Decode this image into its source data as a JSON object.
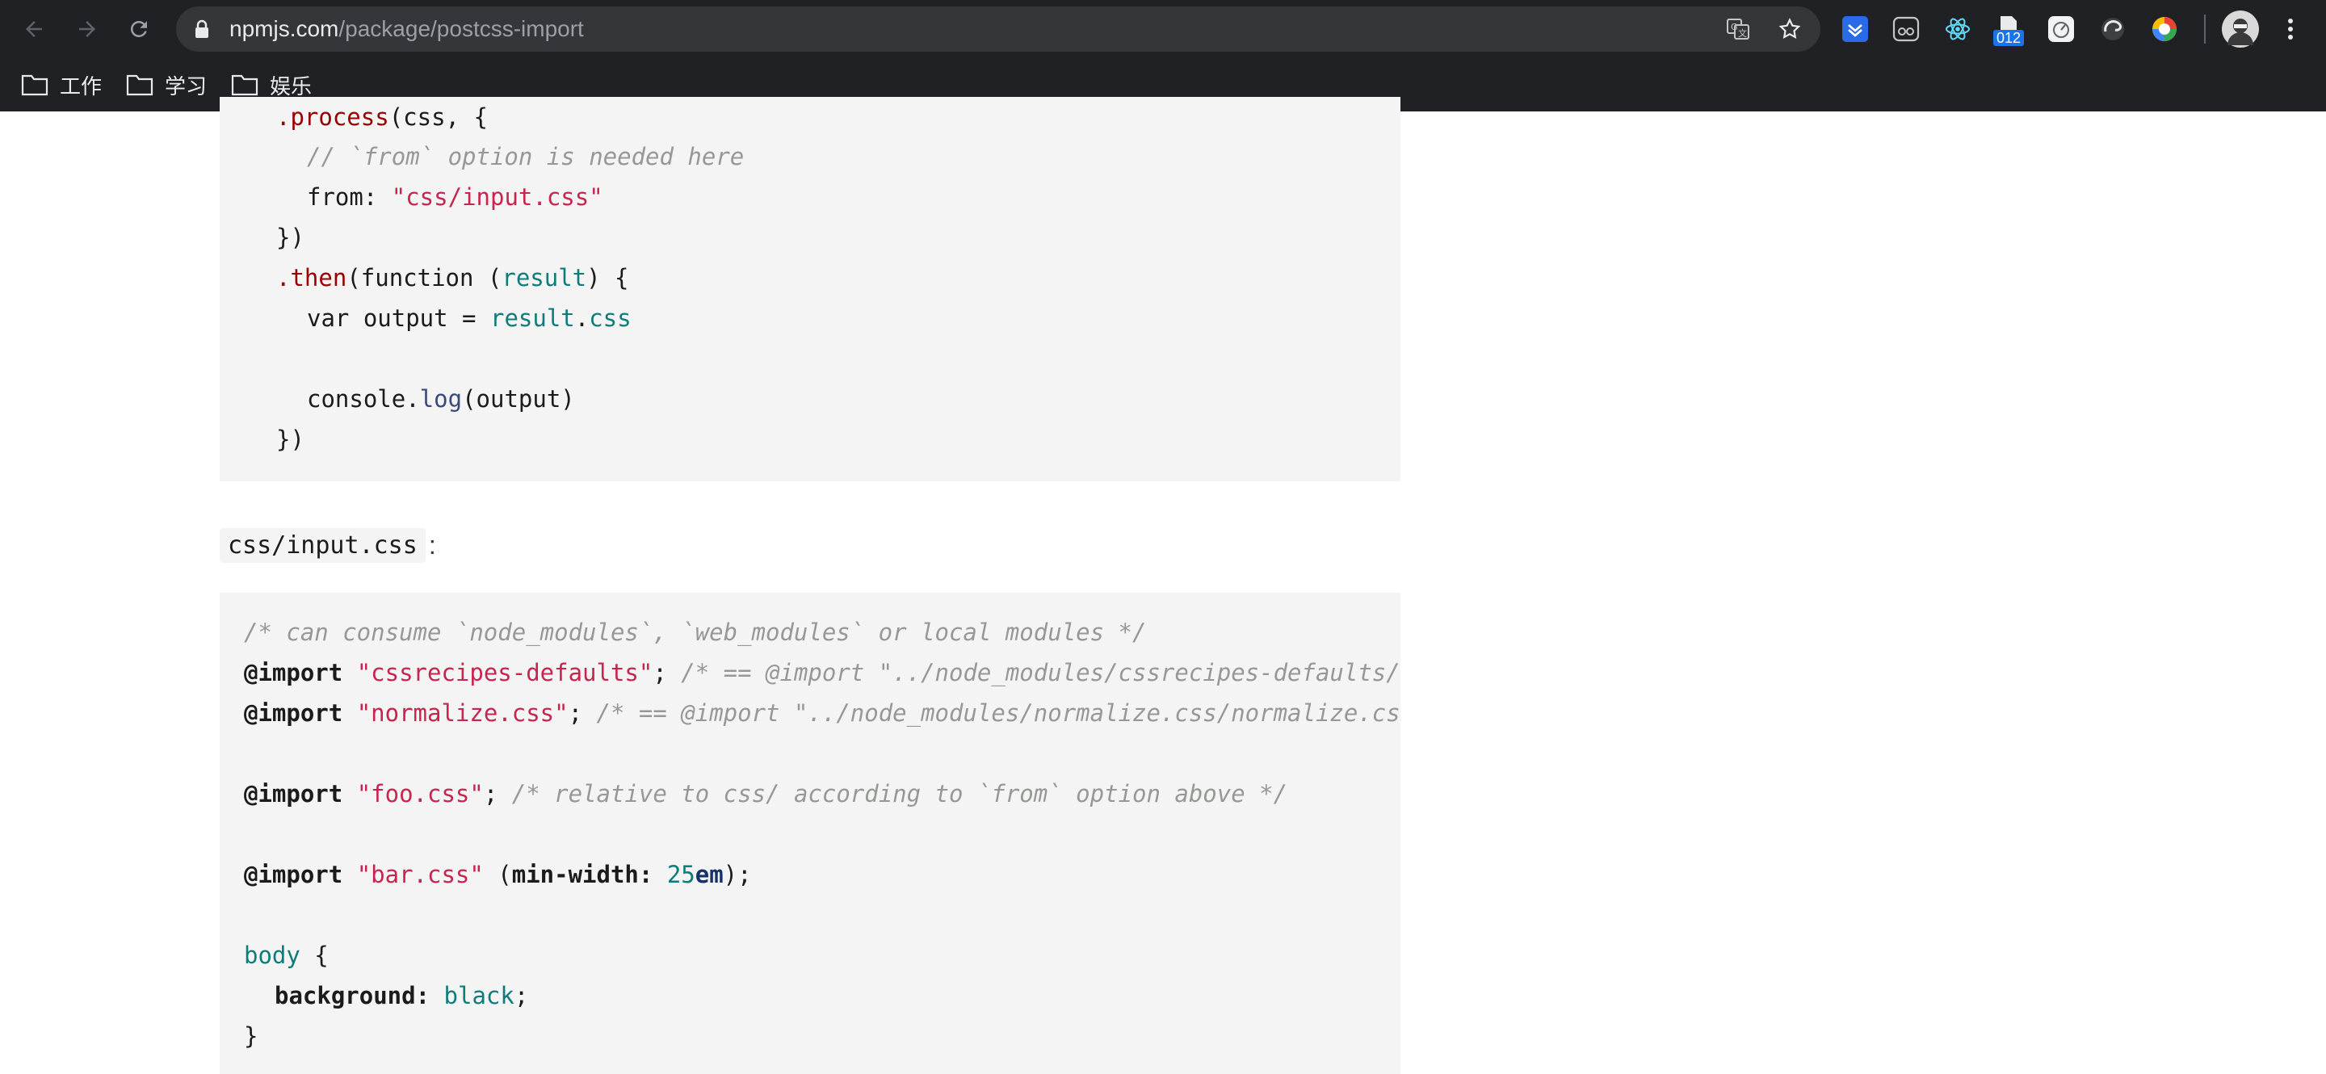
{
  "browser": {
    "url_host": "npmjs.com",
    "url_path": "/package/postcss-import",
    "extension_badge": "012",
    "bookmarks": [
      {
        "label": "工作"
      },
      {
        "label": "学习"
      },
      {
        "label": "娱乐"
      }
    ]
  },
  "page": {
    "js_code": {
      "l1_method": ".process",
      "l1_rest": "(css, {",
      "l2_comment": "// `from` option is needed here",
      "l3_key": "from: ",
      "l3_value": "\"css/input.css\"",
      "l4": "})",
      "l5_method": ".then",
      "l5_a": "(function (",
      "l5_arg": "result",
      "l5_b": ") {",
      "l6_a": "var output = ",
      "l6_obj": "result",
      "l6_dot": ".",
      "l6_prop": "css",
      "l8_a": "console.",
      "l8_fn": "log",
      "l8_b": "(output)",
      "l9": "})"
    },
    "file_label": "css/input.css",
    "file_label_suffix": ":",
    "css_code": {
      "c1": "/* can consume `node_modules`, `web_modules` or local modules */",
      "import_kw": "@import",
      "c2_str": "\"cssrecipes-defaults\"",
      "c2_semi": ";",
      "c2_comment": "/* == @import \"../node_modules/cssrecipes-defaults/index.css\"; */",
      "c3_str": "\"normalize.css\"",
      "c3_semi": ";",
      "c3_comment": "/* == @import \"../node_modules/normalize.css/normalize.css\"; */",
      "c5_str": "\"foo.css\"",
      "c5_semi": ";",
      "c5_comment": "/* relative to css/ according to `from` option above */",
      "c7_str": "\"bar.css\"",
      "c7_a": " (",
      "c7_feature": "min-width:",
      "c7_num": "25",
      "c7_unit": "em",
      "c7_b": ");",
      "c9_sel": "body",
      "c9_brace": " {",
      "c10_prop": "background:",
      "c10_val": "black",
      "c10_semi": ";",
      "c11": "}"
    }
  }
}
